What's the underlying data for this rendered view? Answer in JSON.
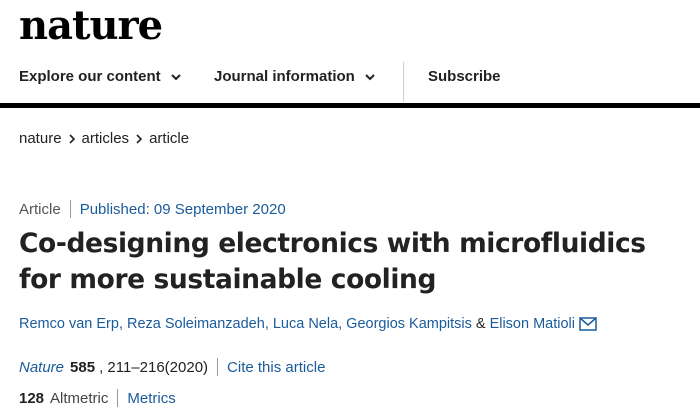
{
  "brand": {
    "logo": "nature"
  },
  "nav": {
    "explore": "Explore our content",
    "journal_info": "Journal information",
    "subscribe": "Subscribe"
  },
  "breadcrumb": [
    "nature",
    "articles",
    "article"
  ],
  "article": {
    "type": "Article",
    "published": "Published: 09 September 2020",
    "title": "Co-designing electronics with microfluidics for more sustainable cooling",
    "authors": [
      "Remco van Erp",
      "Reza Soleimanzadeh",
      "Luca Nela",
      "Georgios Kampitsis",
      "Elison Matioli"
    ],
    "author_amp": "&",
    "citation": {
      "journal": "Nature",
      "volume": "585",
      "pages_year": ", 211–216(2020)",
      "cite_link": "Cite this article"
    },
    "altmetric": {
      "count": "128",
      "label": "Altmetric",
      "metrics_link": "Metrics"
    }
  },
  "colors": {
    "link": "#1a5b9c",
    "text": "#222222",
    "rule": "#000000"
  }
}
